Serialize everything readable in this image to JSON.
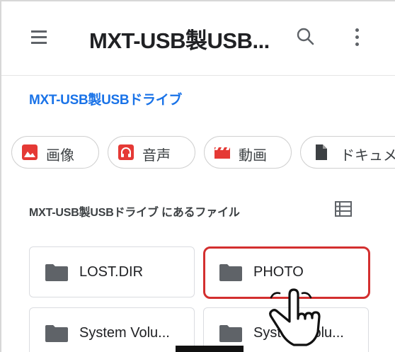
{
  "appbar": {
    "title": "MXT-USB製USB...",
    "menu_icon": "hamburger-menu-icon",
    "search_icon": "search-icon",
    "more_icon": "more-vert-icon"
  },
  "breadcrumb": "MXT-USB製USBドライブ",
  "chips": [
    {
      "label": "画像",
      "icon": "image-icon",
      "color": "#e53935"
    },
    {
      "label": "音声",
      "icon": "headphones-icon",
      "color": "#e53935"
    },
    {
      "label": "動画",
      "icon": "movie-icon",
      "color": "#e53935"
    },
    {
      "label": "ドキュメ",
      "icon": "document-icon",
      "color": "#3c4043"
    }
  ],
  "section": {
    "title": "MXT-USB製USBドライブ にあるファイル",
    "view_toggle_icon": "list-view-icon"
  },
  "folders": [
    {
      "name": "LOST.DIR",
      "selected": false
    },
    {
      "name": "PHOTO",
      "selected": true
    },
    {
      "name": "System Volu...",
      "selected": false
    },
    {
      "name": "System Volu...",
      "selected": false
    }
  ],
  "colors": {
    "accent": "#1a73e8",
    "highlight": "#d32f2f",
    "folder_icon": "#5f6368"
  }
}
